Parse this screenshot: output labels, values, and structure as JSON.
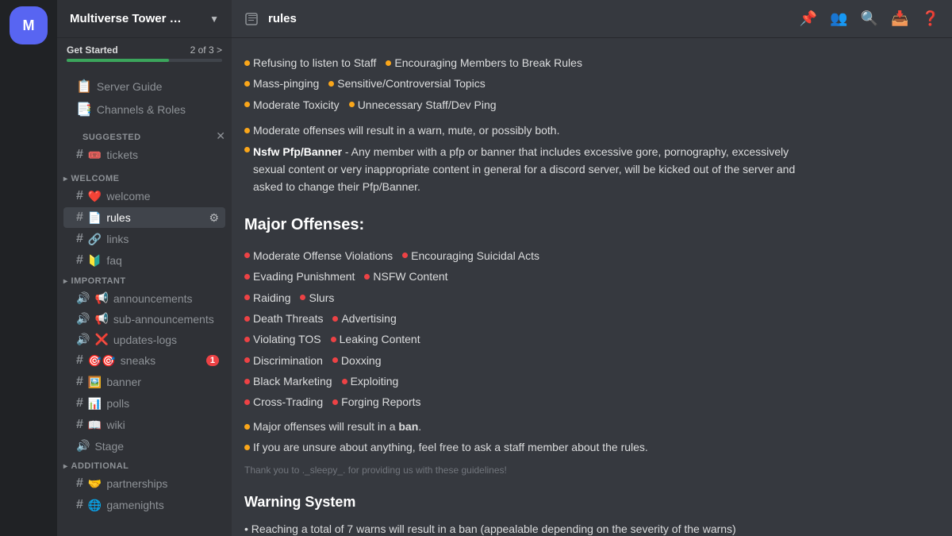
{
  "server": {
    "name": "Multiverse Tower Def...",
    "icon_text": "M"
  },
  "get_started": {
    "label": "Get Started",
    "progress": "2 of 3 >"
  },
  "sidebar": {
    "links": [
      {
        "icon": "📋",
        "name": "Server Guide",
        "id": "server-guide"
      },
      {
        "icon": "📑",
        "name": "Channels & Roles",
        "id": "channels-roles"
      }
    ],
    "suggested_label": "SUGGESTED",
    "suggested_channels": [
      {
        "icon": "#",
        "emoji": "🎟️",
        "name": "tickets",
        "id": "tickets"
      }
    ],
    "categories": [
      {
        "name": "WELCOME",
        "id": "welcome",
        "channels": [
          {
            "icon": "#",
            "emoji": "❤️",
            "name": "welcome",
            "id": "ch-welcome",
            "active": false
          },
          {
            "icon": "#",
            "emoji": "📄",
            "name": "rules",
            "id": "ch-rules",
            "active": true,
            "settings": true
          },
          {
            "icon": "#",
            "emoji": "🔗",
            "name": "links",
            "id": "ch-links",
            "active": false
          },
          {
            "icon": "#",
            "emoji": "🔰",
            "name": "faq",
            "id": "ch-faq",
            "active": false
          }
        ]
      },
      {
        "name": "IMPORTANT",
        "id": "important",
        "channels": [
          {
            "icon": "🔔",
            "emoji": "📢",
            "name": "announcements",
            "id": "ch-announcements"
          },
          {
            "icon": "🔔",
            "emoji": "📢",
            "name": "sub-announcements",
            "id": "ch-sub-announcements"
          },
          {
            "icon": "🔔",
            "emoji": "❌",
            "name": "updates-logs",
            "id": "ch-updates-logs"
          },
          {
            "icon": "#",
            "emoji": "🎯",
            "name": "sneaks",
            "id": "ch-sneaks",
            "badge": "1"
          },
          {
            "icon": "#",
            "emoji": "🖼️",
            "name": "banner",
            "id": "ch-banner"
          }
        ]
      },
      {
        "name": "ADDITIONAL",
        "id": "additional",
        "channels": [
          {
            "icon": "#",
            "emoji": "📊",
            "name": "polls",
            "id": "ch-polls"
          },
          {
            "icon": "#",
            "emoji": "📖",
            "name": "wiki",
            "id": "ch-wiki"
          },
          {
            "icon": "stage",
            "name": "Stage",
            "id": "ch-stage"
          },
          {
            "icon": "#",
            "emoji": "🤝",
            "name": "partnerships",
            "id": "ch-partnerships"
          },
          {
            "icon": "#",
            "emoji": "🌐",
            "name": "gamenights",
            "id": "ch-gamenights"
          }
        ]
      }
    ]
  },
  "topbar": {
    "channel_name": "rules",
    "pin_icon": "📌",
    "mention_icon": "@"
  },
  "content": {
    "moderate_bullets_row1": [
      "Refusing to listen to Staff",
      "Encouraging Members to Break Rules"
    ],
    "moderate_bullets_row2": [
      "Mass-pinging",
      "Sensitive/Controversial Topics"
    ],
    "moderate_bullets_row3": [
      "Moderate Toxicity",
      "Unnecessary Staff/Dev Ping"
    ],
    "moderate_note1": "Moderate offenses will result in a warn, mute, or possibly both.",
    "moderate_note2_bold": "Nsfw Pfp/Banner",
    "moderate_note2_rest": " - Any member with a pfp or banner that includes excessive gore, pornography, excessively sexual content or very inappropriate content in general for a discord server, will be kicked out of the server and asked to change their Pfp/Banner.",
    "major_title": "Major Offenses:",
    "major_bullets": [
      [
        "Moderate Offense Violations",
        "Encouraging Suicidal Acts"
      ],
      [
        "Evading Punishment",
        "NSFW Content"
      ],
      [
        "Raiding",
        "Slurs"
      ],
      [
        "Death Threats",
        "Advertising"
      ],
      [
        "Violating TOS",
        "Leaking Content"
      ],
      [
        "Discrimination",
        "Doxxing"
      ],
      [
        "Black Marketing",
        "Exploiting"
      ],
      [
        "Cross-Trading",
        "Forging Reports"
      ]
    ],
    "major_ban_note_pre": "Major offenses will result in a ",
    "major_ban_note_bold": "ban",
    "major_ban_note_post": ".",
    "staff_note": "If you are unsure about anything, feel free to ask a staff member about the rules.",
    "thank_you": "Thank you to ._sleepy_. for providing us with these guidelines!",
    "warning_title": "Warning System",
    "warning_note": "• Reaching a total of 7 warns will result in a ban (appealable depending on the severity of the warns)"
  }
}
